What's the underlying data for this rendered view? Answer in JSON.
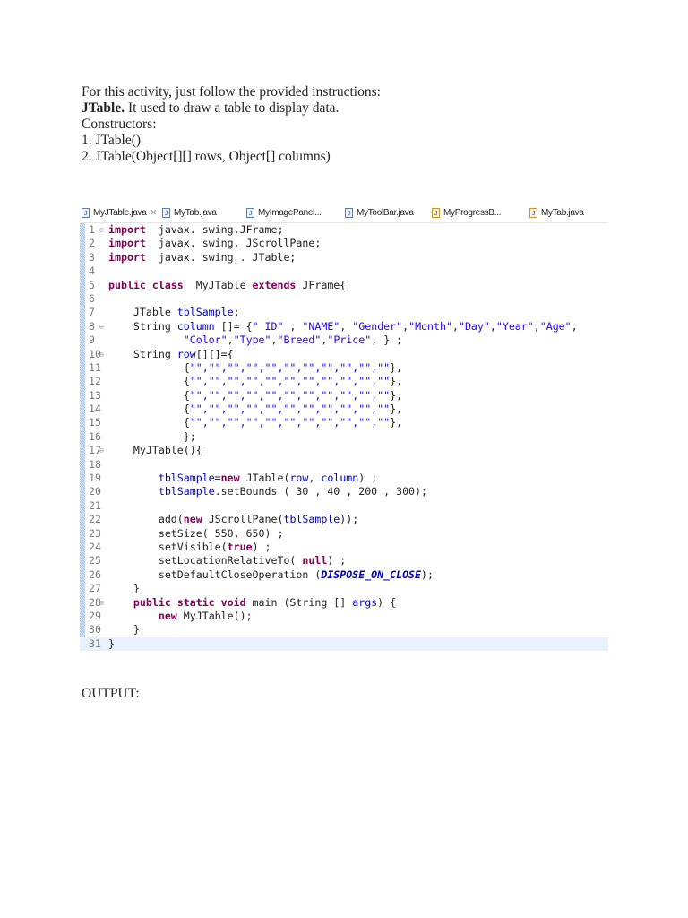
{
  "intro": {
    "line1": "For this activity, just follow the provided instructions:",
    "jtable_bold": "JTable.",
    "jtable_desc": " It used to draw a table to display data.",
    "constructors_label": "Constructors:",
    "constructor1": "1. JTable()",
    "constructor2": "2. JTable(Object[][] rows, Object[] columns)"
  },
  "editor": {
    "tabs": [
      {
        "label": "MyJTable.java",
        "active": true
      },
      {
        "label": "MyTab.java"
      },
      {
        "label": "MyImagePanel..."
      },
      {
        "label": "MyToolBar.java"
      },
      {
        "label": "MyProgressB..."
      },
      {
        "label": "MyTab.java"
      }
    ],
    "close_glyph": "✕",
    "lines": [
      {
        "n": "1",
        "fold": "⊖",
        "t": [
          [
            "kw",
            "import"
          ],
          [
            "",
            "  javax. swing.JFrame;"
          ]
        ]
      },
      {
        "n": "2",
        "t": [
          [
            "kw",
            "import"
          ],
          [
            "",
            "  javax. swing. JScrollPane;"
          ]
        ]
      },
      {
        "n": "3",
        "t": [
          [
            "kw",
            "import"
          ],
          [
            "",
            "  javax. swing . JTable;"
          ]
        ]
      },
      {
        "n": "4",
        "t": []
      },
      {
        "n": "5",
        "t": [
          [
            "kw",
            "public class"
          ],
          [
            "",
            "  MyJTable "
          ],
          [
            "kw",
            "extends"
          ],
          [
            "",
            " JFrame{"
          ]
        ]
      },
      {
        "n": "6",
        "t": []
      },
      {
        "n": "7",
        "t": [
          [
            "",
            "    JTable "
          ],
          [
            "fld",
            "tblSample"
          ],
          [
            "",
            ";"
          ]
        ]
      },
      {
        "n": "8",
        "fold": "⊖",
        "t": [
          [
            "",
            "    String "
          ],
          [
            "fld",
            "column"
          ],
          [
            "",
            " []= {"
          ],
          [
            "str",
            "\" ID\""
          ],
          [
            "",
            " , "
          ],
          [
            "str",
            "\"NAME\""
          ],
          [
            "",
            ", "
          ],
          [
            "str",
            "\"Gender\""
          ],
          [
            "",
            ","
          ],
          [
            "str",
            "\"Month\""
          ],
          [
            "",
            ","
          ],
          [
            "str",
            "\"Day\""
          ],
          [
            "",
            ","
          ],
          [
            "str",
            "\"Year\""
          ],
          [
            "",
            ","
          ],
          [
            "str",
            "\"Age\""
          ],
          [
            "",
            ","
          ]
        ]
      },
      {
        "n": "9",
        "t": [
          [
            "",
            "            "
          ],
          [
            "str",
            "\"Color\""
          ],
          [
            "",
            ","
          ],
          [
            "str",
            "\"Type\""
          ],
          [
            "",
            ","
          ],
          [
            "str",
            "\"Breed\""
          ],
          [
            "",
            ","
          ],
          [
            "str",
            "\"Price\""
          ],
          [
            "",
            ", } ;"
          ]
        ]
      },
      {
        "n": "10",
        "fold": "⊖",
        "t": [
          [
            "",
            "    String "
          ],
          [
            "fld",
            "row"
          ],
          [
            "",
            "[][]={"
          ]
        ]
      },
      {
        "n": "11",
        "t": [
          [
            "",
            "            {"
          ],
          [
            "str",
            "\"\",\"\",\"\",\"\",\"\",\"\",\"\",\"\",\"\",\"\",\"\""
          ],
          [
            "",
            "},"
          ]
        ]
      },
      {
        "n": "12",
        "t": [
          [
            "",
            "            {"
          ],
          [
            "str",
            "\"\",\"\",\"\",\"\",\"\",\"\",\"\",\"\",\"\",\"\",\"\""
          ],
          [
            "",
            "},"
          ]
        ]
      },
      {
        "n": "13",
        "t": [
          [
            "",
            "            {"
          ],
          [
            "str",
            "\"\",\"\",\"\",\"\",\"\",\"\",\"\",\"\",\"\",\"\",\"\""
          ],
          [
            "",
            "},"
          ]
        ]
      },
      {
        "n": "14",
        "t": [
          [
            "",
            "            {"
          ],
          [
            "str",
            "\"\",\"\",\"\",\"\",\"\",\"\",\"\",\"\",\"\",\"\",\"\""
          ],
          [
            "",
            "},"
          ]
        ]
      },
      {
        "n": "15",
        "t": [
          [
            "",
            "            {"
          ],
          [
            "str",
            "\"\",\"\",\"\",\"\",\"\",\"\",\"\",\"\",\"\",\"\",\"\""
          ],
          [
            "",
            "},"
          ]
        ]
      },
      {
        "n": "16",
        "t": [
          [
            "",
            "            };"
          ]
        ]
      },
      {
        "n": "17",
        "fold": "⊖",
        "t": [
          [
            "",
            "    MyJTable(){"
          ]
        ]
      },
      {
        "n": "18",
        "t": []
      },
      {
        "n": "19",
        "t": [
          [
            "",
            "        "
          ],
          [
            "fld",
            "tblSample"
          ],
          [
            "",
            "="
          ],
          [
            "kw",
            "new"
          ],
          [
            "",
            " JTable("
          ],
          [
            "fld",
            "row"
          ],
          [
            "",
            ", "
          ],
          [
            "fld",
            "column"
          ],
          [
            "",
            ") ;"
          ]
        ]
      },
      {
        "n": "20",
        "t": [
          [
            "",
            "        "
          ],
          [
            "fld",
            "tblSample"
          ],
          [
            "",
            ".setBounds ( 30 , 40 , 200 , 300);"
          ]
        ]
      },
      {
        "n": "21",
        "t": []
      },
      {
        "n": "22",
        "t": [
          [
            "",
            "        add("
          ],
          [
            "kw",
            "new"
          ],
          [
            "",
            " JScrollPane("
          ],
          [
            "fld",
            "tblSample"
          ],
          [
            "",
            "));"
          ]
        ]
      },
      {
        "n": "23",
        "t": [
          [
            "",
            "        setSize( 550, 650) ;"
          ]
        ]
      },
      {
        "n": "24",
        "t": [
          [
            "",
            "        setVisible("
          ],
          [
            "kw",
            "true"
          ],
          [
            "",
            ") ;"
          ]
        ]
      },
      {
        "n": "25",
        "t": [
          [
            "",
            "        setLocationRelativeTo( "
          ],
          [
            "kw",
            "null"
          ],
          [
            "",
            ") ;"
          ]
        ]
      },
      {
        "n": "26",
        "t": [
          [
            "",
            "        setDefaultCloseOperation ("
          ],
          [
            "const",
            "DISPOSE_ON_CLOSE"
          ],
          [
            "",
            ");"
          ]
        ]
      },
      {
        "n": "27",
        "t": [
          [
            "",
            "    }"
          ]
        ]
      },
      {
        "n": "28",
        "fold": "⊖",
        "t": [
          [
            "",
            "    "
          ],
          [
            "kw",
            "public static void"
          ],
          [
            "",
            " main (String [] "
          ],
          [
            "fld",
            "args"
          ],
          [
            "",
            ") {"
          ]
        ]
      },
      {
        "n": "29",
        "t": [
          [
            "",
            "        "
          ],
          [
            "kw",
            "new"
          ],
          [
            "",
            " MyJTable();"
          ]
        ]
      },
      {
        "n": "30",
        "t": [
          [
            "",
            "    }"
          ]
        ]
      },
      {
        "n": "31",
        "t": [
          [
            "",
            "}"
          ]
        ],
        "current": true
      }
    ]
  },
  "output_label": "OUTPUT:"
}
